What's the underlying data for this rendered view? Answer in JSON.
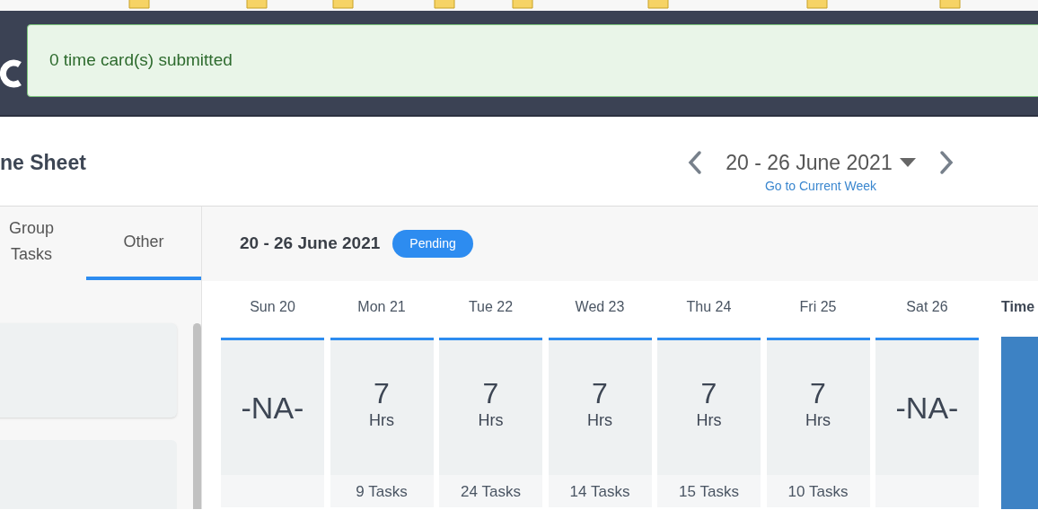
{
  "notification": {
    "message": "0 time card(s) submitted"
  },
  "page": {
    "title": "ne Sheet"
  },
  "week_nav": {
    "range": "20 - 26 June 2021",
    "current_week_link": "Go to Current Week"
  },
  "tabs": [
    {
      "label": "Group Tasks",
      "selected": false
    },
    {
      "label": "Other",
      "selected": true
    }
  ],
  "week": {
    "range": "20 - 26 June 2021",
    "status": "Pending"
  },
  "days": [
    {
      "label": "Sun 20",
      "kind": "na",
      "value": "-NA-"
    },
    {
      "label": "Mon 21",
      "kind": "hours",
      "value": "7",
      "unit": "Hrs",
      "tasks": "9 Tasks"
    },
    {
      "label": "Tue 22",
      "kind": "hours",
      "value": "7",
      "unit": "Hrs",
      "tasks": "24 Tasks"
    },
    {
      "label": "Wed 23",
      "kind": "hours",
      "value": "7",
      "unit": "Hrs",
      "tasks": "14 Tasks"
    },
    {
      "label": "Thu 24",
      "kind": "hours",
      "value": "7",
      "unit": "Hrs",
      "tasks": "15 Tasks"
    },
    {
      "label": "Fri 25",
      "kind": "hours",
      "value": "7",
      "unit": "Hrs",
      "tasks": "10 Tasks"
    },
    {
      "label": "Sat 26",
      "kind": "na",
      "value": "-NA-"
    }
  ],
  "summary": {
    "heading": "Time"
  }
}
